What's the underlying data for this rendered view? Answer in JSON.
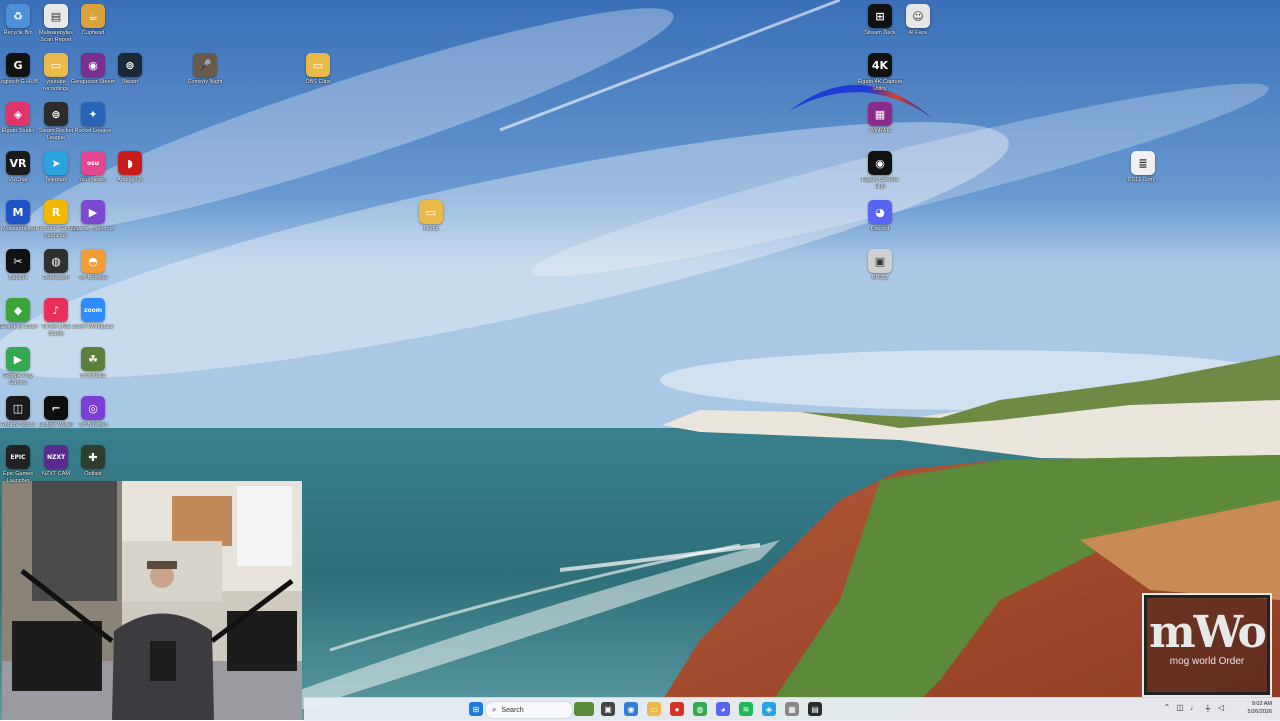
{
  "desktop": {
    "icons": [
      {
        "label": "Recycle Bin",
        "icon": "recycle-bin-icon",
        "color": "#4d8fd6",
        "glyph": "♻",
        "col": 0,
        "row": 0
      },
      {
        "label": "Malwarebytes Scan Report",
        "icon": "document-icon",
        "color": "#e8e8e8",
        "glyph": "▤",
        "col": 1,
        "row": 0
      },
      {
        "label": "Cuphead",
        "icon": "cuphead-icon",
        "color": "#d9a23a",
        "glyph": "☕",
        "col": 2,
        "row": 0
      },
      {
        "label": "Logitech G HUB",
        "icon": "logitech-icon",
        "color": "#111111",
        "glyph": "G",
        "col": 0,
        "row": 1
      },
      {
        "label": "youtube recordings",
        "icon": "folder-icon",
        "color": "#e9b949",
        "glyph": "▭",
        "col": 1,
        "row": 1
      },
      {
        "label": "Geoguessr Steam",
        "icon": "geoguessr-icon",
        "color": "#7b2f8f",
        "glyph": "◉",
        "col": 2,
        "row": 1
      },
      {
        "label": "Steam",
        "icon": "steam-icon",
        "color": "#1b2838",
        "glyph": "⊚",
        "col": 3,
        "row": 1
      },
      {
        "label": "Elgato Studio",
        "icon": "elgato-studio-icon",
        "color": "#e0356b",
        "glyph": "◈",
        "col": 0,
        "row": 2
      },
      {
        "label": "Steam Rocket League",
        "icon": "steam-icon",
        "color": "#2b2b2b",
        "glyph": "⊚",
        "col": 1,
        "row": 2
      },
      {
        "label": "Rocket League",
        "icon": "rocket-league-icon",
        "color": "#2a64b8",
        "glyph": "✦",
        "col": 2,
        "row": 2
      },
      {
        "label": "VRChat",
        "icon": "vrchat-icon",
        "color": "#1a1a1a",
        "glyph": "VR",
        "col": 0,
        "row": 3
      },
      {
        "label": "Telegram",
        "icon": "telegram-icon",
        "color": "#2aa3e0",
        "glyph": "➤",
        "col": 1,
        "row": 3
      },
      {
        "label": "osu!(lazer)",
        "icon": "osu-icon",
        "color": "#e2478f",
        "glyph": "osu",
        "col": 2,
        "row": 3
      },
      {
        "label": "Among Us",
        "icon": "among-us-icon",
        "color": "#c81b1b",
        "glyph": "◗",
        "col": 3,
        "row": 3
      },
      {
        "label": "Malwarebytes",
        "icon": "malwarebytes-icon",
        "color": "#1f53c7",
        "glyph": "M",
        "col": 0,
        "row": 4
      },
      {
        "label": "Rockstar Games Launcher",
        "icon": "rockstar-icon",
        "color": "#f2b705",
        "glyph": "R",
        "col": 1,
        "row": 4
      },
      {
        "label": "Videos - Shortcut",
        "icon": "videos-icon",
        "color": "#7a4bd1",
        "glyph": "▶",
        "col": 2,
        "row": 4
      },
      {
        "label": "CapCut",
        "icon": "capcut-icon",
        "color": "#111111",
        "glyph": "✂",
        "col": 0,
        "row": 5
      },
      {
        "label": "Overwatch",
        "icon": "overwatch-icon",
        "color": "#303030",
        "glyph": "◍",
        "col": 1,
        "row": 5
      },
      {
        "label": "Tor Browser",
        "icon": "tor-browser-icon",
        "color": "#f29d38",
        "glyph": "◓",
        "col": 2,
        "row": 5
      },
      {
        "label": "Geometry Dash",
        "icon": "geometry-dash-icon",
        "color": "#3aa53a",
        "glyph": "◆",
        "col": 0,
        "row": 6
      },
      {
        "label": "TikTok LIVE Studio",
        "icon": "tiktok-icon",
        "color": "#ea2f5a",
        "glyph": "♪",
        "col": 1,
        "row": 6
      },
      {
        "label": "Zoom Workplace",
        "icon": "zoom-icon",
        "color": "#2d8cff",
        "glyph": "zoom",
        "col": 2,
        "row": 6
      },
      {
        "label": "Google Play Games",
        "icon": "google-play-games-icon",
        "color": "#34a853",
        "glyph": "▶",
        "col": 0,
        "row": 7
      },
      {
        "label": "Brawlhalla",
        "icon": "brawlhalla-icon",
        "color": "#5b7f3a",
        "glyph": "☘",
        "col": 2,
        "row": 7
      },
      {
        "label": "Roblox Studio",
        "icon": "roblox-icon",
        "color": "#1a1a1a",
        "glyph": "◫",
        "col": 0,
        "row": 8
      },
      {
        "label": "Ledger Wallet",
        "icon": "ledger-icon",
        "color": "#0f0f0f",
        "glyph": "⌐",
        "col": 1,
        "row": 8
      },
      {
        "label": "Tor Browser",
        "icon": "tor-browser-icon",
        "color": "#7b3fd1",
        "glyph": "◎",
        "col": 2,
        "row": 8
      },
      {
        "label": "Epic Games Launcher",
        "icon": "epic-games-icon",
        "color": "#222222",
        "glyph": "EPIC",
        "col": 0,
        "row": 9
      },
      {
        "label": "NZXT CAM",
        "icon": "nzxt-cam-icon",
        "color": "#5a2a8e",
        "glyph": "NZXT",
        "col": 1,
        "row": 9
      },
      {
        "label": "Outlast",
        "icon": "outlast-icon",
        "color": "#2f3d2f",
        "glyph": "✚",
        "col": 2,
        "row": 9
      }
    ],
    "free_icons": [
      {
        "label": "Comedy Night",
        "icon": "microphone-icon",
        "color": "#6a5a4a",
        "glyph": "🎤",
        "pos": "cn"
      },
      {
        "label": "OBS Clips",
        "icon": "folder-icon",
        "color": "#e9b949",
        "glyph": "▭",
        "pos": "obs"
      },
      {
        "label": "Media",
        "icon": "folder-icon",
        "color": "#e9b949",
        "glyph": "▭",
        "pos": "media"
      },
      {
        "label": "Stream Deck",
        "icon": "stream-deck-icon",
        "color": "#111111",
        "glyph": "⊞",
        "pos": "sd"
      },
      {
        "label": "AI Face",
        "icon": "ai-face-icon",
        "color": "#e6e6e6",
        "glyph": "☺",
        "pos": "aif"
      },
      {
        "label": "Elgato 4K Capture Utility",
        "icon": "elgato-4k-icon",
        "color": "#111111",
        "glyph": "4K",
        "pos": "e4k"
      },
      {
        "label": "WinRAR",
        "icon": "winrar-icon",
        "color": "#8a2b8a",
        "glyph": "▦",
        "pos": "rar"
      },
      {
        "label": "Elgato Camera Hub",
        "icon": "camera-hub-icon",
        "color": "#111111",
        "glyph": "◉",
        "pos": "ech"
      },
      {
        "label": "Discord",
        "icon": "discord-icon",
        "color": "#5865f2",
        "glyph": "◕",
        "pos": "dc"
      },
      {
        "label": "CPU-Z",
        "icon": "cpu-z-icon",
        "color": "#d0d0d0",
        "glyph": "▣",
        "pos": "cpuz"
      },
      {
        "label": "DS11 Com...",
        "icon": "document-icon",
        "color": "#f0f0f0",
        "glyph": "≣",
        "pos": "ds11"
      }
    ]
  },
  "taskbar": {
    "search_placeholder": "Search",
    "apps": [
      {
        "name": "start-button",
        "color": "#1e7be0",
        "glyph": "⊞"
      },
      {
        "name": "task-view-button",
        "color": "#444444",
        "glyph": "▣"
      },
      {
        "name": "browser-button",
        "color": "#2f7fd6",
        "glyph": "◉"
      },
      {
        "name": "file-explorer-button",
        "color": "#e9b949",
        "glyph": "▭"
      },
      {
        "name": "red-app-button",
        "color": "#d93025",
        "glyph": "●"
      },
      {
        "name": "chrome-button",
        "color": "#34a853",
        "glyph": "◍"
      },
      {
        "name": "discord-taskbar-button",
        "color": "#5865f2",
        "glyph": "◕"
      },
      {
        "name": "spotify-button",
        "color": "#1db954",
        "glyph": "≋"
      },
      {
        "name": "store-button",
        "color": "#2aa3e0",
        "glyph": "◈"
      },
      {
        "name": "calculator-button",
        "color": "#888888",
        "glyph": "▦"
      },
      {
        "name": "notes-button",
        "color": "#2b2b2b",
        "glyph": "▤"
      }
    ],
    "tray_icons": [
      "chevron-up-icon",
      "network-icon",
      "microphone-icon",
      "usb-icon",
      "sound-icon"
    ],
    "time": "9:02 AM",
    "date": "5/26/2026"
  },
  "overlay": {
    "logo_text": "mWo",
    "logo_subtitle": "mog world Order"
  }
}
